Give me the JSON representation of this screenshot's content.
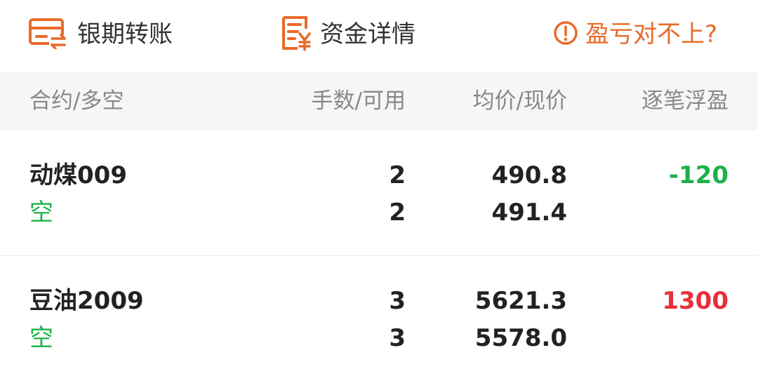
{
  "toolbar": {
    "bank_transfer": {
      "label": "银期转账",
      "icon": "bank-transfer-icon"
    },
    "fund_details": {
      "label": "资金详情",
      "icon": "fund-details-icon"
    },
    "pnl_mismatch": {
      "label": "盈亏对不上?",
      "icon": "info-circle-icon"
    }
  },
  "colors": {
    "accent": "#e96a2a",
    "profit": "#e8303a",
    "loss": "#1db148",
    "short": "#1db148",
    "header_bg": "#f5f6f8"
  },
  "table": {
    "headers": {
      "contract": "合约/多空",
      "lots": "手数/可用",
      "price": "均价/现价",
      "pnl": "逐笔浮盈"
    },
    "rows": [
      {
        "name": "动煤009",
        "direction": "空",
        "lots": "2",
        "available": "2",
        "avg_price": "490.8",
        "current_price": "491.4",
        "pnl": "-120"
      },
      {
        "name": "豆油2009",
        "direction": "空",
        "lots": "3",
        "available": "3",
        "avg_price": "5621.3",
        "current_price": "5578.0",
        "pnl": "1300"
      }
    ]
  }
}
